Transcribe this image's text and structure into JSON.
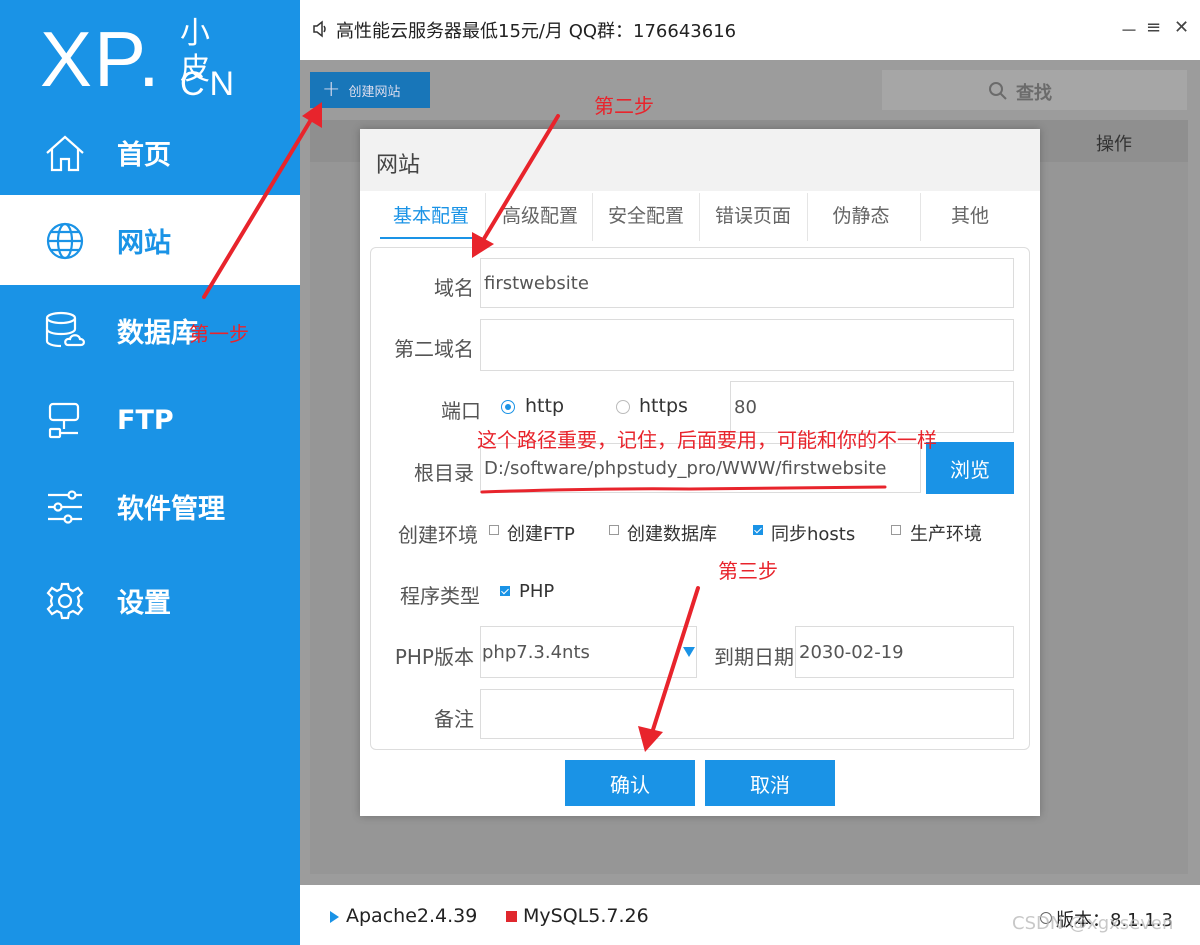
{
  "logo": {
    "brand": "XP.",
    "small": "小皮",
    "cn": "CN"
  },
  "sidebar": {
    "items": [
      {
        "label": "首页",
        "icon": "home-icon"
      },
      {
        "label": "网站",
        "icon": "globe-icon",
        "active": true
      },
      {
        "label": "数据库",
        "icon": "database-icon"
      },
      {
        "label": "FTP",
        "icon": "ftp-icon"
      },
      {
        "label": "软件管理",
        "icon": "sliders-icon"
      },
      {
        "label": "设置",
        "icon": "gear-icon"
      }
    ]
  },
  "topbar": {
    "notice": "高性能云服务器最低15元/月  QQ群：176643616",
    "minimize": "－",
    "menu": "≡",
    "close": "✕"
  },
  "toolbar": {
    "create_label": "创建网站",
    "search_placeholder": "查找",
    "op_header": "操作"
  },
  "modal": {
    "title": "网站",
    "tabs": [
      "基本配置",
      "高级配置",
      "安全配置",
      "错误页面",
      "伪静态",
      "其他"
    ],
    "form": {
      "domain_label": "域名",
      "domain_value": "firstwebsite",
      "domain2_label": "第二域名",
      "domain2_value": "",
      "port_label": "端口",
      "http_label": "http",
      "https_label": "https",
      "port_value": "80",
      "root_label": "根目录",
      "root_value": "D:/software/phpstudy_pro/WWW/firstwebsite",
      "browse_label": "浏览",
      "env_label": "创建环境",
      "env_options": [
        {
          "label": "创建FTP",
          "checked": false
        },
        {
          "label": "创建数据库",
          "checked": false
        },
        {
          "label": "同步hosts",
          "checked": true
        },
        {
          "label": "生产环境",
          "checked": false
        }
      ],
      "prog_label": "程序类型",
      "prog_option": "PHP",
      "php_label": "PHP版本",
      "php_value": "php7.3.4nts",
      "expire_label": "到期日期",
      "expire_value": "2030-02-19",
      "note_label": "备注",
      "note_value": ""
    },
    "confirm_label": "确认",
    "cancel_label": "取消"
  },
  "statusbar": {
    "apache": "Apache2.4.39",
    "mysql": "MySQL5.7.26",
    "version": "版本：8.1.1.3",
    "watermark": "CSDN @xgxseven"
  },
  "annotations": {
    "step1": "第一步",
    "step2": "第二步",
    "step3": "第三步",
    "path_note": "这个路径重要，记住，后面要用，可能和你的不一样"
  },
  "colors": {
    "accent": "#1a93e6",
    "annotation": "#e8242c"
  }
}
